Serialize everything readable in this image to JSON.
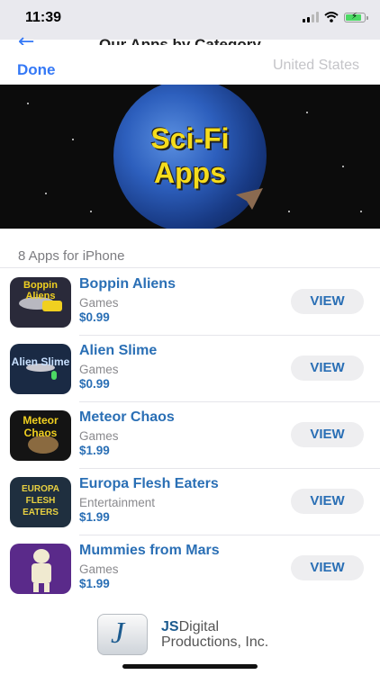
{
  "status_bar": {
    "time": "11:39"
  },
  "background_screen": {
    "title": "Our Apps by Category"
  },
  "sheet": {
    "done_label": "Done",
    "country": "United States"
  },
  "banner": {
    "line1": "Sci-Fi",
    "line2": "Apps"
  },
  "section_header": "8 Apps for iPhone",
  "apps": [
    {
      "name": "Boppin Aliens",
      "category": "Games",
      "price": "$0.99",
      "button": "VIEW",
      "icon_text": "Boppin Aliens",
      "icon_color": "#2a2a3a"
    },
    {
      "name": "Alien Slime",
      "category": "Games",
      "price": "$0.99",
      "button": "VIEW",
      "icon_text": "Alien Slime",
      "icon_color": "#1a2a44"
    },
    {
      "name": "Meteor Chaos",
      "category": "Games",
      "price": "$1.99",
      "button": "VIEW",
      "icon_text": "Meteor Chaos",
      "icon_color": "#141414"
    },
    {
      "name": "Europa Flesh Eaters",
      "category": "Entertainment",
      "price": "$1.99",
      "button": "VIEW",
      "icon_text": "EUROPA FLESH EATERS",
      "icon_color": "#1f2f3f"
    },
    {
      "name": "Mummies from Mars",
      "category": "Games",
      "price": "$1.99",
      "button": "VIEW",
      "icon_text": "",
      "icon_color": "#5a2a8a"
    }
  ],
  "footer": {
    "brand_js": "JS",
    "brand_rest": "Digital",
    "brand_line2": "Productions, Inc."
  },
  "colors": {
    "link_blue": "#2a6fb5",
    "done_blue": "#3478f6"
  }
}
